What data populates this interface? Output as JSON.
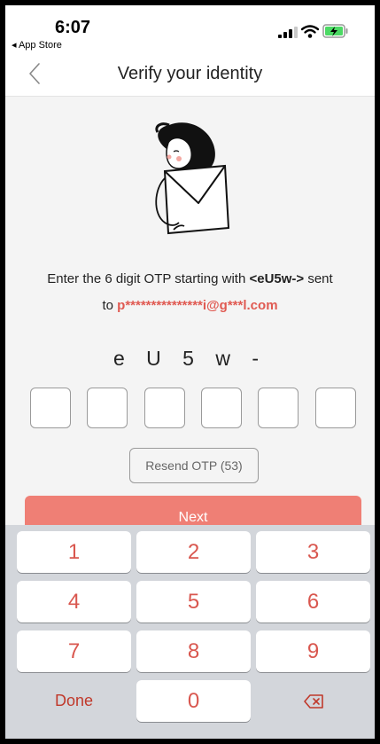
{
  "status_bar": {
    "time": "6:07",
    "back_app": "◂ App Store"
  },
  "nav": {
    "title": "Verify your identity"
  },
  "instruction": {
    "pre": "Enter the 6 digit OTP starting with ",
    "code": "<eU5w->",
    "mid": " sent",
    "to": "to ",
    "email": "p***************i@g***l.com"
  },
  "otp_prefix": "e U 5 w -",
  "otp_digits": [
    "",
    "",
    "",
    "",
    "",
    ""
  ],
  "resend_label": "Resend OTP (53)",
  "next_label": "Next",
  "keypad": {
    "keys": [
      "1",
      "2",
      "3",
      "4",
      "5",
      "6",
      "7",
      "8",
      "9"
    ],
    "done_label": "Done",
    "zero": "0",
    "delete_icon": "backspace-icon"
  },
  "colors": {
    "accent": "#ef7f75",
    "accent_text": "#e05a52",
    "keypad_digit": "#d9574f"
  }
}
